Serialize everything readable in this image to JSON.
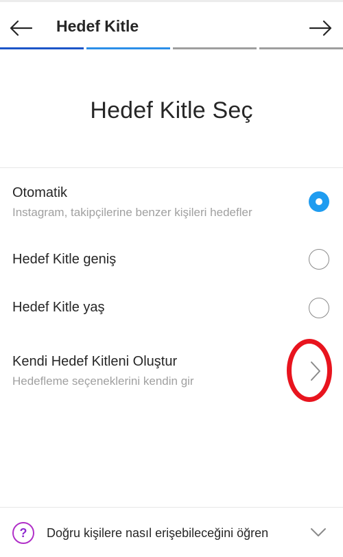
{
  "header": {
    "title": "Hedef Kitle",
    "back_icon": "arrow-left-icon",
    "next_icon": "arrow-right-icon"
  },
  "progress": {
    "steps_total": 4,
    "steps_completed": 2,
    "colors": [
      "#1c55c8",
      "#2a8ee8",
      "#9e9e9e",
      "#9e9e9e"
    ]
  },
  "heading": "Hedef Kitle Seç",
  "options": [
    {
      "label": "Otomatik",
      "sub": "Instagram, takipçilerine benzer kişileri hedefler",
      "selected": true
    },
    {
      "label": "Hedef Kitle geniş",
      "sub": "",
      "selected": false
    },
    {
      "label": "Hedef Kitle yaş",
      "sub": "",
      "selected": false
    }
  ],
  "custom": {
    "label": "Kendi Hedef Kitleni Oluştur",
    "sub": "Hedefleme seçeneklerini kendin gir",
    "icon": "chevron-right-icon"
  },
  "footer": {
    "icon_glyph": "?",
    "icon": "help-icon",
    "text": "Doğru kişilere nasıl erişebileceğini öğren",
    "chevron_icon": "chevron-down-icon"
  },
  "colors": {
    "accent": "#1f9cf0",
    "annotation": "#e8141e"
  }
}
